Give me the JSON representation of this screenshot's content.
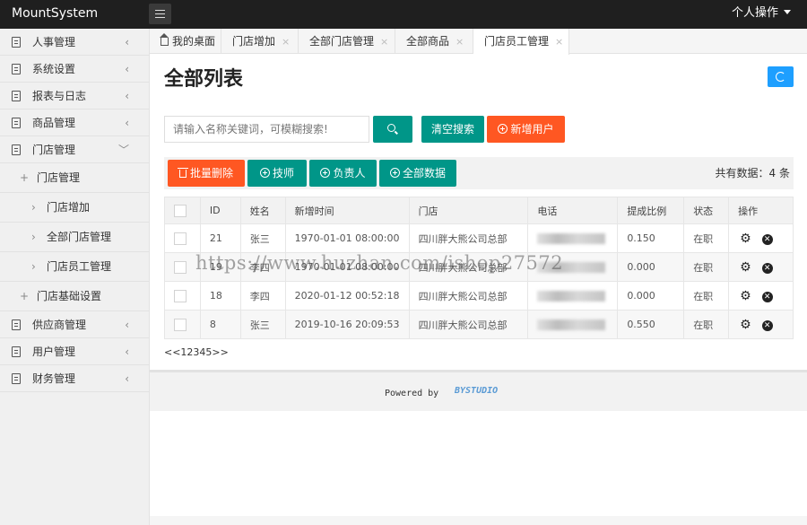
{
  "app": {
    "brand": "MountSystem",
    "user_menu": "个人操作"
  },
  "sidebar": {
    "items": [
      {
        "label": "人事管理",
        "chevron": "‹"
      },
      {
        "label": "系统设置",
        "chevron": "‹"
      },
      {
        "label": "报表与日志",
        "chevron": "‹"
      },
      {
        "label": "商品管理",
        "chevron": "‹"
      },
      {
        "label": "门店管理",
        "chevron": "﹀"
      }
    ],
    "store_children": {
      "group": "门店管理",
      "sub": [
        "门店增加",
        "全部门店管理",
        "门店员工管理"
      ],
      "basic": "门店基础设置"
    },
    "items_bottom": [
      {
        "label": "供应商管理",
        "chevron": "‹"
      },
      {
        "label": "用户管理",
        "chevron": "‹"
      },
      {
        "label": "财务管理",
        "chevron": "‹"
      }
    ]
  },
  "tabs": [
    {
      "label": "我的桌面",
      "close": ""
    },
    {
      "label": "门店增加",
      "close": "×"
    },
    {
      "label": "全部门店管理",
      "close": "×"
    },
    {
      "label": "全部商品",
      "close": "×"
    },
    {
      "label": "门店员工管理",
      "close": "×"
    }
  ],
  "page": {
    "title": "全部列表"
  },
  "search": {
    "placeholder": "请输入名称关键词，可模糊搜索!",
    "clear_label": "清空搜索",
    "add_label": "新增用户"
  },
  "toolbar": {
    "batch_delete": "批量删除",
    "tech": "技师",
    "manager": "负责人",
    "all": "全部数据",
    "total": "共有数据：4 条"
  },
  "table": {
    "headers": [
      "ID",
      "姓名",
      "新增时间",
      "门店",
      "电话",
      "提成比例",
      "状态",
      "操作"
    ],
    "rows": [
      {
        "id": "21",
        "name": "张三",
        "time": "1970-01-01 08:00:00",
        "store": "四川胖大熊公司总部",
        "rate": "0.150",
        "status": "在职"
      },
      {
        "id": "19",
        "name": "李四",
        "time": "1970-01-01 08:00:00",
        "store": "四川胖大熊公司总部",
        "rate": "0.000",
        "status": "在职"
      },
      {
        "id": "18",
        "name": "李四",
        "time": "2020-01-12 00:52:18",
        "store": "四川胖大熊公司总部",
        "rate": "0.000",
        "status": "在职"
      },
      {
        "id": "8",
        "name": "张三",
        "time": "2019-10-16 20:09:53",
        "store": "四川胖大熊公司总部",
        "rate": "0.550",
        "status": "在职"
      }
    ]
  },
  "pager": {
    "text": "<<12345>>"
  },
  "footer": {
    "powered": "Powered by",
    "studio": "BYSTUDIO"
  },
  "watermark": "https://www.huzhan.com/ishop27572",
  "icons": {
    "gear": "⚙",
    "delete": "✕"
  }
}
